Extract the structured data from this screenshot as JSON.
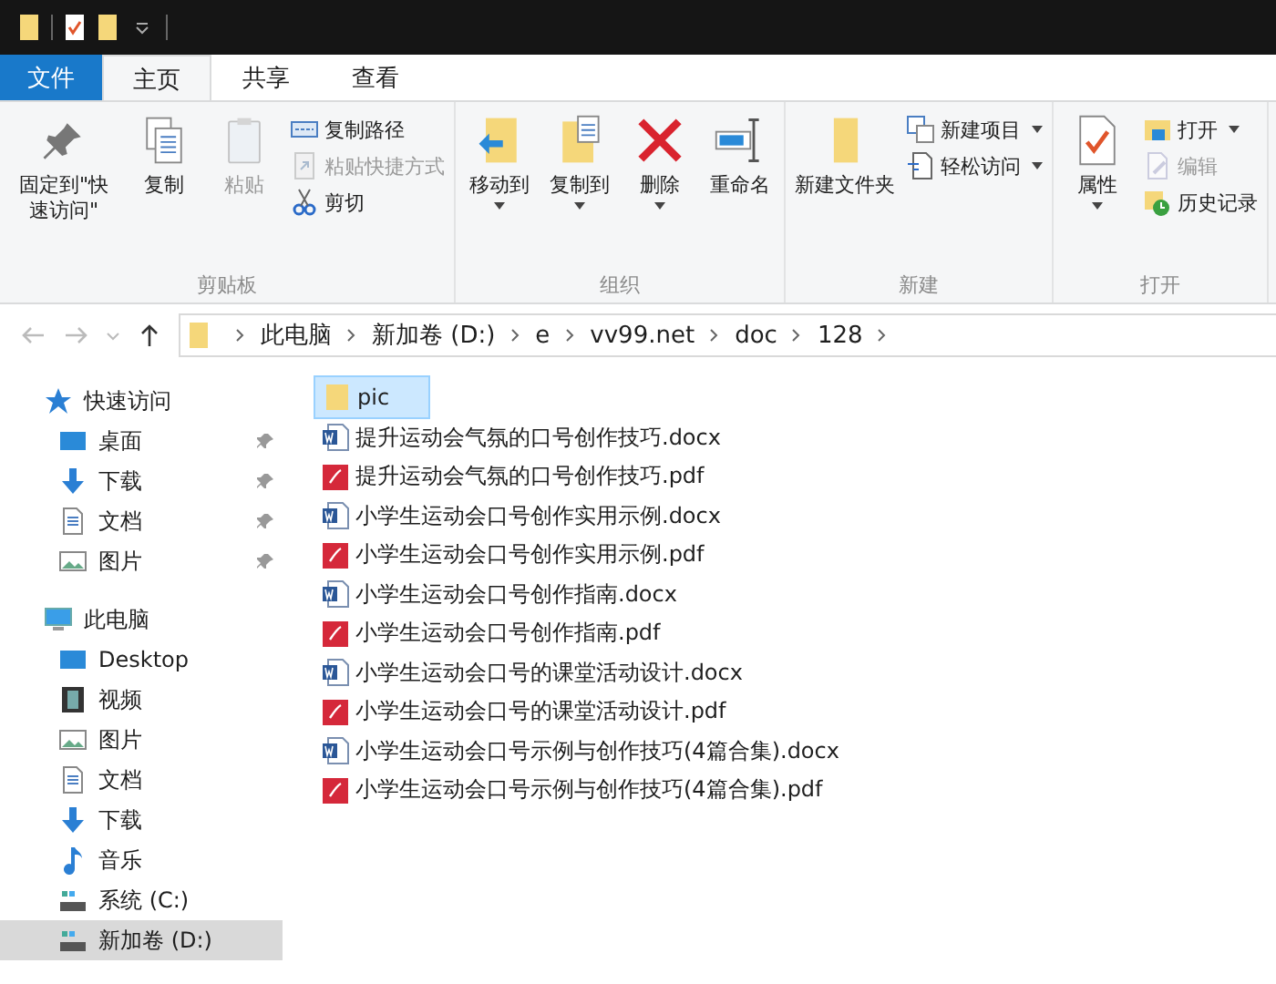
{
  "ribbon": {
    "tabs": [
      {
        "label": "文件",
        "kind": "file",
        "selected": false
      },
      {
        "label": "主页",
        "kind": "tab",
        "selected": true
      },
      {
        "label": "共享",
        "kind": "tab",
        "selected": false
      },
      {
        "label": "查看",
        "kind": "tab",
        "selected": false
      }
    ],
    "groups": [
      {
        "label": "剪贴板",
        "commands": [
          {
            "label": "固定到\"快速访问\"",
            "kind": "large",
            "disabled": false,
            "dropdown": false
          },
          {
            "label": "复制",
            "kind": "large",
            "disabled": false,
            "dropdown": false
          },
          {
            "label": "粘贴",
            "kind": "large",
            "disabled": true,
            "dropdown": false
          },
          {
            "label": "复制路径",
            "kind": "small",
            "disabled": false,
            "dropdown": false
          },
          {
            "label": "粘贴快捷方式",
            "kind": "small",
            "disabled": true,
            "dropdown": false
          },
          {
            "label": "剪切",
            "kind": "small",
            "disabled": false,
            "dropdown": false
          }
        ]
      },
      {
        "label": "组织",
        "commands": [
          {
            "label": "移动到",
            "kind": "large",
            "disabled": false,
            "dropdown": true
          },
          {
            "label": "复制到",
            "kind": "large",
            "disabled": false,
            "dropdown": true
          },
          {
            "label": "删除",
            "kind": "large",
            "disabled": false,
            "dropdown": true
          },
          {
            "label": "重命名",
            "kind": "large",
            "disabled": false,
            "dropdown": false
          }
        ]
      },
      {
        "label": "新建",
        "commands": [
          {
            "label": "新建文件夹",
            "kind": "large",
            "disabled": false,
            "dropdown": false
          },
          {
            "label": "新建项目",
            "kind": "small",
            "disabled": false,
            "dropdown": true
          },
          {
            "label": "轻松访问",
            "kind": "small",
            "disabled": false,
            "dropdown": true
          }
        ]
      },
      {
        "label": "打开",
        "commands": [
          {
            "label": "属性",
            "kind": "large",
            "disabled": false,
            "dropdown": true
          },
          {
            "label": "打开",
            "kind": "small",
            "disabled": false,
            "dropdown": true
          },
          {
            "label": "编辑",
            "kind": "small",
            "disabled": true,
            "dropdown": false
          },
          {
            "label": "历史记录",
            "kind": "small",
            "disabled": false,
            "dropdown": false
          }
        ]
      }
    ]
  },
  "address_bar": {
    "path": [
      "此电脑",
      "新加卷 (D:)",
      "e",
      "vv99.net",
      "doc",
      "128"
    ]
  },
  "sidebar": {
    "sections": [
      {
        "label": "快速访问",
        "kind": "star",
        "selected": false,
        "children": [
          {
            "label": "桌面",
            "kind": "desktop",
            "pinned": true,
            "selected": false
          },
          {
            "label": "下载",
            "kind": "download",
            "pinned": true,
            "selected": false
          },
          {
            "label": "文档",
            "kind": "document",
            "pinned": true,
            "selected": false
          },
          {
            "label": "图片",
            "kind": "picture",
            "pinned": true,
            "selected": false
          }
        ]
      },
      {
        "label": "此电脑",
        "kind": "computer",
        "selected": false,
        "children": [
          {
            "label": "Desktop",
            "kind": "desktop",
            "pinned": false,
            "selected": false
          },
          {
            "label": "视频",
            "kind": "video",
            "pinned": false,
            "selected": false
          },
          {
            "label": "图片",
            "kind": "picture",
            "pinned": false,
            "selected": false
          },
          {
            "label": "文档",
            "kind": "document",
            "pinned": false,
            "selected": false
          },
          {
            "label": "下载",
            "kind": "download",
            "pinned": false,
            "selected": false
          },
          {
            "label": "音乐",
            "kind": "music",
            "pinned": false,
            "selected": false
          },
          {
            "label": "系统 (C:)",
            "kind": "drive",
            "pinned": false,
            "selected": false
          },
          {
            "label": "新加卷 (D:)",
            "kind": "drive",
            "pinned": false,
            "selected": true
          }
        ]
      }
    ]
  },
  "files": [
    {
      "name": "pic",
      "kind": "folder",
      "selected": true
    },
    {
      "name": "提升运动会气氛的口号创作技巧.docx",
      "kind": "docx",
      "selected": false
    },
    {
      "name": "提升运动会气氛的口号创作技巧.pdf",
      "kind": "pdf",
      "selected": false
    },
    {
      "name": "小学生运动会口号创作实用示例.docx",
      "kind": "docx",
      "selected": false
    },
    {
      "name": "小学生运动会口号创作实用示例.pdf",
      "kind": "pdf",
      "selected": false
    },
    {
      "name": "小学生运动会口号创作指南.docx",
      "kind": "docx",
      "selected": false
    },
    {
      "name": "小学生运动会口号创作指南.pdf",
      "kind": "pdf",
      "selected": false
    },
    {
      "name": "小学生运动会口号的课堂活动设计.docx",
      "kind": "docx",
      "selected": false
    },
    {
      "name": "小学生运动会口号的课堂活动设计.pdf",
      "kind": "pdf",
      "selected": false
    },
    {
      "name": "小学生运动会口号示例与创作技巧(4篇合集).docx",
      "kind": "docx",
      "selected": false
    },
    {
      "name": "小学生运动会口号示例与创作技巧(4篇合集).pdf",
      "kind": "pdf",
      "selected": false
    }
  ]
}
